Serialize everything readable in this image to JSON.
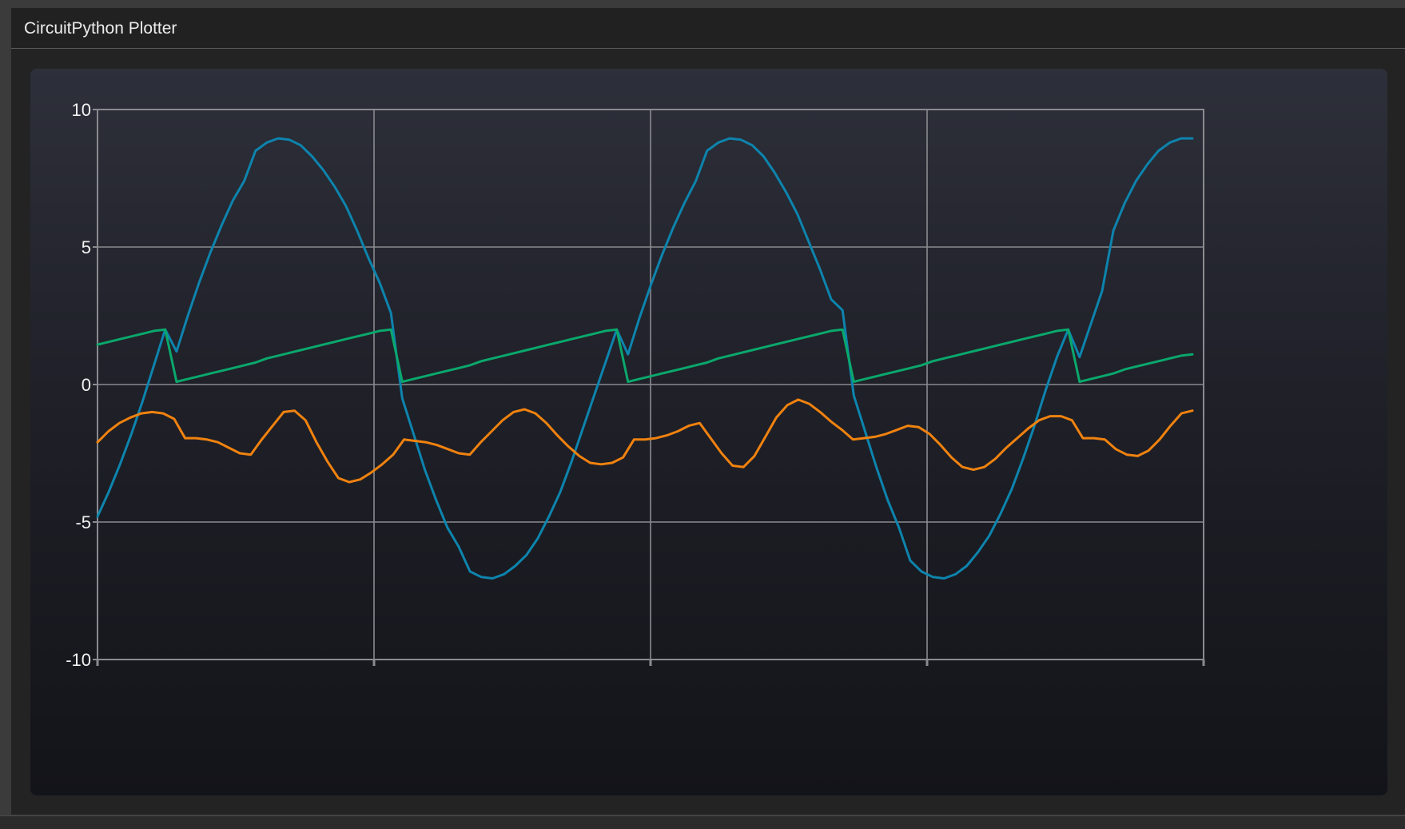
{
  "window": {
    "title": "CircuitPython Plotter"
  },
  "colors": {
    "series1": "#0d84ad",
    "series2": "#0aa86c",
    "series3": "#f0820f",
    "grid": "#8a8b90",
    "tick_text": "#f2f2f2"
  },
  "chart_data": {
    "type": "line",
    "title": "",
    "xlabel": "",
    "ylabel": "",
    "ylim": [
      -10,
      10
    ],
    "yticks": [
      "10",
      "5",
      "0",
      "-5",
      "-10"
    ],
    "xlim": [
      0,
      120
    ],
    "grid": true,
    "legend": "none",
    "series": [
      {
        "values": [
          -4.8,
          -3.9,
          -2.9,
          -1.8,
          -0.6,
          0.7,
          2.0,
          1.2,
          2.5,
          3.7,
          4.8,
          5.8,
          6.7,
          7.4,
          8.5,
          8.8,
          8.95,
          8.9,
          8.7,
          8.3,
          7.8,
          7.2,
          6.5,
          5.6,
          4.6,
          3.7,
          2.6,
          -0.5,
          -1.8,
          -3.1,
          -4.2,
          -5.2,
          -5.9,
          -6.8,
          -7.0,
          -7.05,
          -6.9,
          -6.6,
          -6.2,
          -5.6,
          -4.8,
          -3.9,
          -2.8,
          -1.6,
          -0.4,
          0.8,
          2.0,
          1.1,
          2.4,
          3.6,
          4.7,
          5.7,
          6.6,
          7.4,
          8.5,
          8.8,
          8.95,
          8.9,
          8.7,
          8.3,
          7.7,
          7.0,
          6.2,
          5.2,
          4.2,
          3.1,
          2.7,
          -0.4,
          -1.7,
          -3.0,
          -4.2,
          -5.2,
          -6.4,
          -6.8,
          -7.0,
          -7.05,
          -6.9,
          -6.6,
          -6.1,
          -5.5,
          -4.7,
          -3.8,
          -2.7,
          -1.5,
          -0.2,
          1.0,
          2.0,
          1.0,
          2.2,
          3.4,
          5.6,
          6.6,
          7.4,
          8.0,
          8.5,
          8.8,
          8.95,
          8.95
        ],
        "_note": ""
      },
      {
        "values": [
          1.45,
          1.55,
          1.65,
          1.75,
          1.85,
          1.95,
          2.0,
          0.1,
          0.2,
          0.3,
          0.4,
          0.5,
          0.6,
          0.7,
          0.8,
          0.95,
          1.05,
          1.15,
          1.25,
          1.35,
          1.45,
          1.55,
          1.65,
          1.75,
          1.85,
          1.95,
          2.0,
          0.1,
          0.2,
          0.3,
          0.4,
          0.5,
          0.6,
          0.7,
          0.85,
          0.95,
          1.05,
          1.15,
          1.25,
          1.35,
          1.45,
          1.55,
          1.65,
          1.75,
          1.85,
          1.95,
          2.0,
          0.1,
          0.2,
          0.3,
          0.4,
          0.5,
          0.6,
          0.7,
          0.8,
          0.95,
          1.05,
          1.15,
          1.25,
          1.35,
          1.45,
          1.55,
          1.65,
          1.75,
          1.85,
          1.95,
          2.0,
          0.1,
          0.2,
          0.3,
          0.4,
          0.5,
          0.6,
          0.7,
          0.85,
          0.95,
          1.05,
          1.15,
          1.25,
          1.35,
          1.45,
          1.55,
          1.65,
          1.75,
          1.85,
          1.95,
          2.0,
          0.1,
          0.2,
          0.3,
          0.4,
          0.55,
          0.65,
          0.75,
          0.85,
          0.95,
          1.05,
          1.1
        ]
      },
      {
        "values": [
          -2.1,
          -1.7,
          -1.4,
          -1.2,
          -1.05,
          -1.0,
          -1.05,
          -1.25,
          -1.95,
          -1.95,
          -2.0,
          -2.1,
          -2.3,
          -2.5,
          -2.55,
          -2.0,
          -1.5,
          -1.0,
          -0.95,
          -1.3,
          -2.1,
          -2.8,
          -3.4,
          -3.55,
          -3.45,
          -3.2,
          -2.9,
          -2.55,
          -2.0,
          -2.05,
          -2.1,
          -2.2,
          -2.35,
          -2.5,
          -2.55,
          -2.1,
          -1.7,
          -1.3,
          -1.0,
          -0.9,
          -1.05,
          -1.4,
          -1.85,
          -2.25,
          -2.6,
          -2.85,
          -2.9,
          -2.85,
          -2.65,
          -2.0,
          -2.0,
          -1.95,
          -1.85,
          -1.7,
          -1.5,
          -1.4,
          -1.95,
          -2.5,
          -2.95,
          -3.0,
          -2.6,
          -1.9,
          -1.2,
          -0.75,
          -0.55,
          -0.7,
          -1.0,
          -1.35,
          -1.65,
          -2.0,
          -1.95,
          -1.9,
          -1.8,
          -1.65,
          -1.5,
          -1.55,
          -1.8,
          -2.2,
          -2.65,
          -3.0,
          -3.1,
          -3.0,
          -2.7,
          -2.3,
          -1.95,
          -1.6,
          -1.3,
          -1.15,
          -1.15,
          -1.3,
          -1.95,
          -1.95,
          -2.0,
          -2.35,
          -2.55,
          -2.6,
          -2.4,
          -2.0,
          -1.5,
          -1.05,
          -0.95
        ]
      }
    ]
  }
}
